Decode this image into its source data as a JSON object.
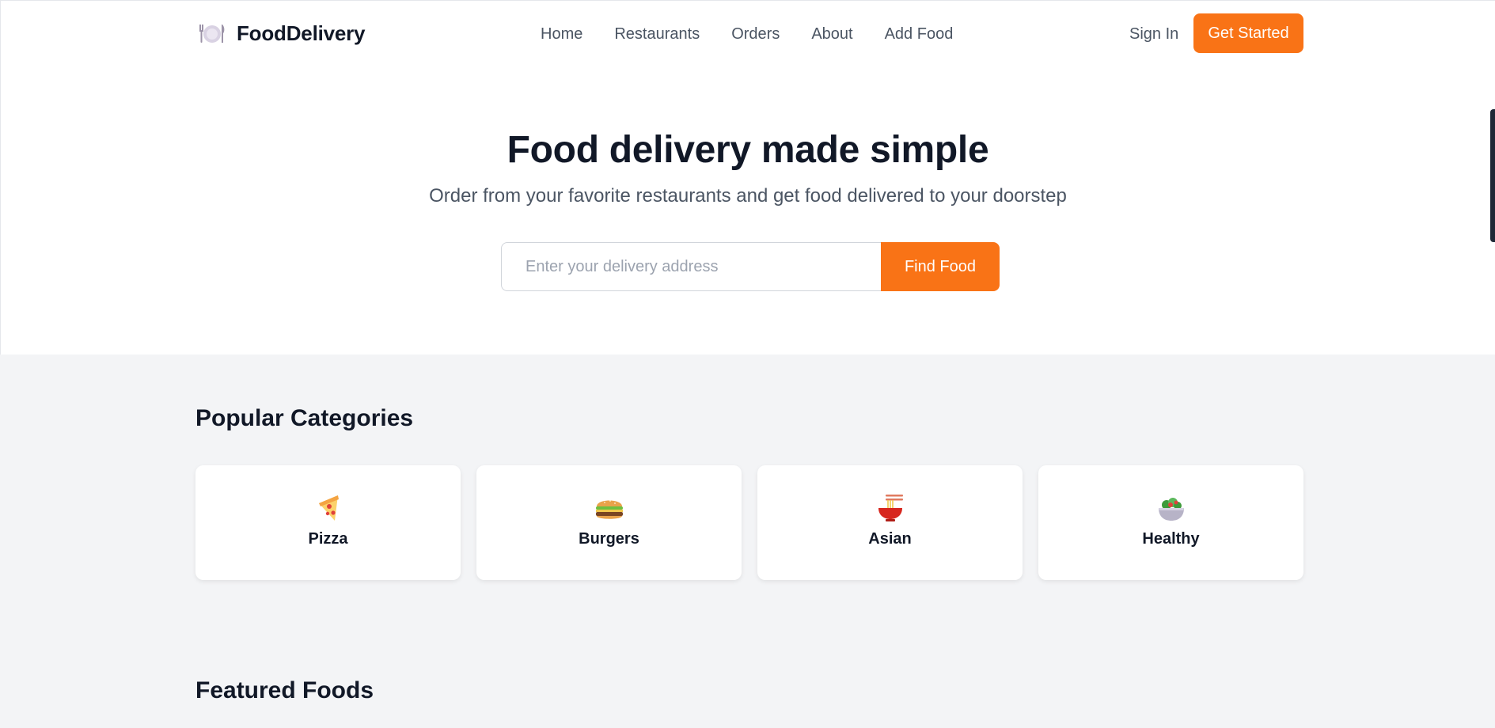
{
  "brand": {
    "name": "FoodDelivery",
    "icon": "plate-icon"
  },
  "nav": {
    "items": [
      {
        "label": "Home"
      },
      {
        "label": "Restaurants"
      },
      {
        "label": "Orders"
      },
      {
        "label": "About"
      },
      {
        "label": "Add Food"
      }
    ],
    "signin_label": "Sign In",
    "cta_label": "Get Started"
  },
  "hero": {
    "title": "Food delivery made simple",
    "subtitle": "Order from your favorite restaurants and get food delivered to your doorstep",
    "search_placeholder": "Enter your delivery address",
    "search_value": "",
    "search_button": "Find Food"
  },
  "categories": {
    "title": "Popular Categories",
    "items": [
      {
        "label": "Pizza",
        "icon": "pizza-icon"
      },
      {
        "label": "Burgers",
        "icon": "burger-icon"
      },
      {
        "label": "Asian",
        "icon": "noodles-icon"
      },
      {
        "label": "Healthy",
        "icon": "salad-icon"
      }
    ]
  },
  "featured": {
    "title": "Featured Foods"
  },
  "colors": {
    "accent": "#f97316",
    "text": "#111827",
    "muted": "#4b5563",
    "section_bg": "#f3f4f6"
  }
}
